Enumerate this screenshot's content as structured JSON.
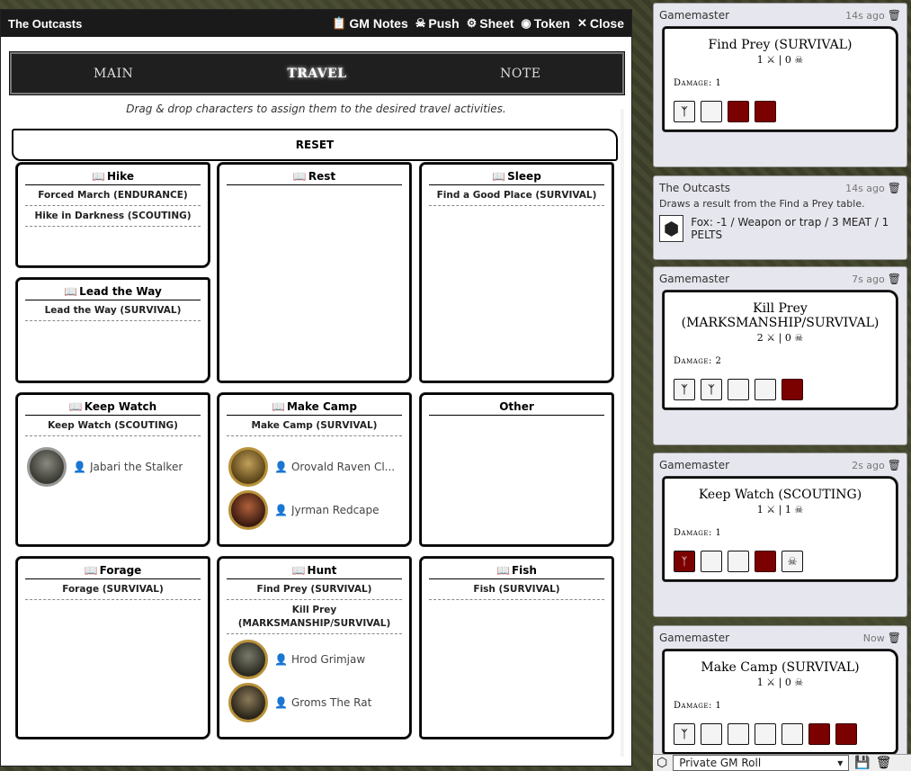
{
  "window": {
    "title": "The Outcasts",
    "buttons": [
      "GM Notes",
      "Push",
      "Sheet",
      "Token",
      "Close"
    ]
  },
  "tabs": [
    "MAIN",
    "TRAVEL",
    "NOTE"
  ],
  "hint": "Drag & drop characters to assign them to the desired travel activities.",
  "reset": "RESET",
  "boxes": {
    "hike": {
      "title": "Hike",
      "skills": [
        "Forced March (ENDURANCE)",
        "Hike in Darkness (SCOUTING)"
      ]
    },
    "lead": {
      "title": "Lead the Way",
      "skills": [
        "Lead the Way (SURVIVAL)"
      ]
    },
    "rest": {
      "title": "Rest"
    },
    "sleep": {
      "title": "Sleep",
      "skills": [
        "Find a Good Place (SURVIVAL)"
      ]
    },
    "keep": {
      "title": "Keep Watch",
      "skills": [
        "Keep Watch (SCOUTING)"
      ],
      "chars": [
        "Jabari the Stalker"
      ]
    },
    "camp": {
      "title": "Make Camp",
      "skills": [
        "Make Camp (SURVIVAL)"
      ],
      "chars": [
        "Orovald Raven Cl...",
        "Jyrman Redcape"
      ]
    },
    "other": {
      "title": "Other"
    },
    "forage": {
      "title": "Forage",
      "skills": [
        "Forage (SURVIVAL)"
      ]
    },
    "hunt": {
      "title": "Hunt",
      "skills": [
        "Find Prey (SURVIVAL)",
        "Kill Prey (MARKSMANSHIP/SURVIVAL)"
      ],
      "chars": [
        "Hrod Grimjaw",
        "Groms The Rat"
      ]
    },
    "fish": {
      "title": "Fish",
      "skills": [
        "Fish (SURVIVAL)"
      ]
    }
  },
  "chat": [
    {
      "who": "Gamemaster",
      "time": "14s ago",
      "title": "Find Prey (SURVIVAL)",
      "score": "1 ⚔ | 0 ☠",
      "damage": "Damage: 1"
    },
    {
      "who": "The Outcasts",
      "time": "14s ago",
      "draw": "Draws a result from the Find a Prey table.",
      "result": "Fox: -1 / Weapon or trap / 3 MEAT / 1 PELTS"
    },
    {
      "who": "Gamemaster",
      "time": "7s ago",
      "title": "Kill Prey (MARKSMANSHIP/SURVIVAL)",
      "score": "2 ⚔ | 0 ☠",
      "damage": "Damage: 2"
    },
    {
      "who": "Gamemaster",
      "time": "2s ago",
      "title": "Keep Watch (SCOUTING)",
      "score": "1 ⚔ | 1 ☠",
      "damage": "Damage: 1"
    },
    {
      "who": "Gamemaster",
      "time": "Now",
      "title": "Make Camp (SURVIVAL)",
      "score": "1 ⚔ | 0 ☠",
      "damage": "Damage: 1"
    }
  ],
  "roll_mode": "Private GM Roll",
  "colors": {
    "accent_red": "#7b0000",
    "avatar_border": "#b8923a"
  }
}
